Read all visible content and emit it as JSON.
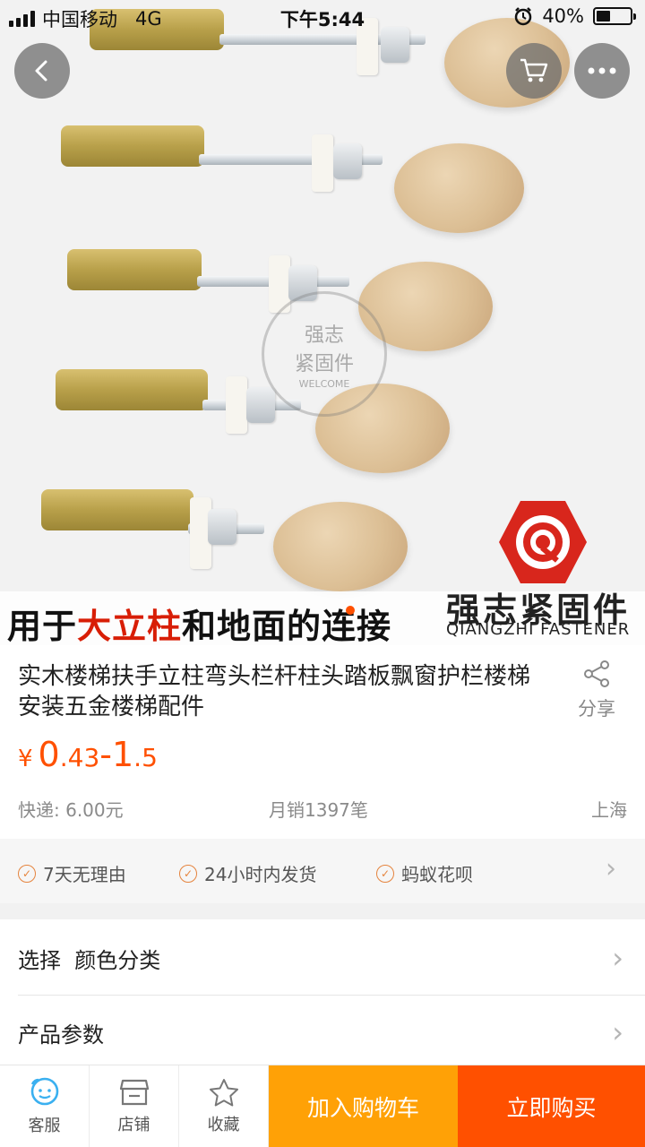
{
  "status_bar": {
    "carrier": "中国移动",
    "network": "4G",
    "time": "下午5:44",
    "battery": "40%"
  },
  "hero": {
    "banner_prefix": "用于",
    "banner_highlight": "大立柱",
    "banner_suffix": "和地面的连接",
    "brand_cn": "强志紧固件",
    "brand_en": "QIANGZHI FASTENER",
    "watermark_cn_1": "强志",
    "watermark_cn_2": "紧固件",
    "watermark_en": "WELCOME"
  },
  "product": {
    "title": "实木楼梯扶手立柱弯头栏杆柱头踏板飘窗护栏楼梯安装五金楼梯配件",
    "share_label": "分享",
    "price_symbol": "¥",
    "price_low_int": "0",
    "price_low_dec": ".43",
    "price_sep": "-",
    "price_high_int": "1",
    "price_high_dec": ".5",
    "shipping": "快递: 6.00元",
    "monthly_sales": "月销1397笔",
    "location": "上海"
  },
  "services": [
    {
      "label": "7天无理由",
      "icon": "check-circle-icon"
    },
    {
      "label": "24小时内发货",
      "icon": "check-circle-icon"
    },
    {
      "label": "蚂蚁花呗",
      "icon": "check-circle-icon"
    }
  ],
  "options": {
    "select_label": "选择  颜色分类",
    "params_label": "产品参数"
  },
  "bottom_bar": {
    "service_label": "客服",
    "shop_label": "店铺",
    "favorite_label": "收藏",
    "add_cart_label": "加入购物车",
    "buy_now_label": "立即购买"
  },
  "colors": {
    "accent": "#ff5000",
    "cart_button": "#ffa106",
    "service_icon": "#e5843e"
  }
}
